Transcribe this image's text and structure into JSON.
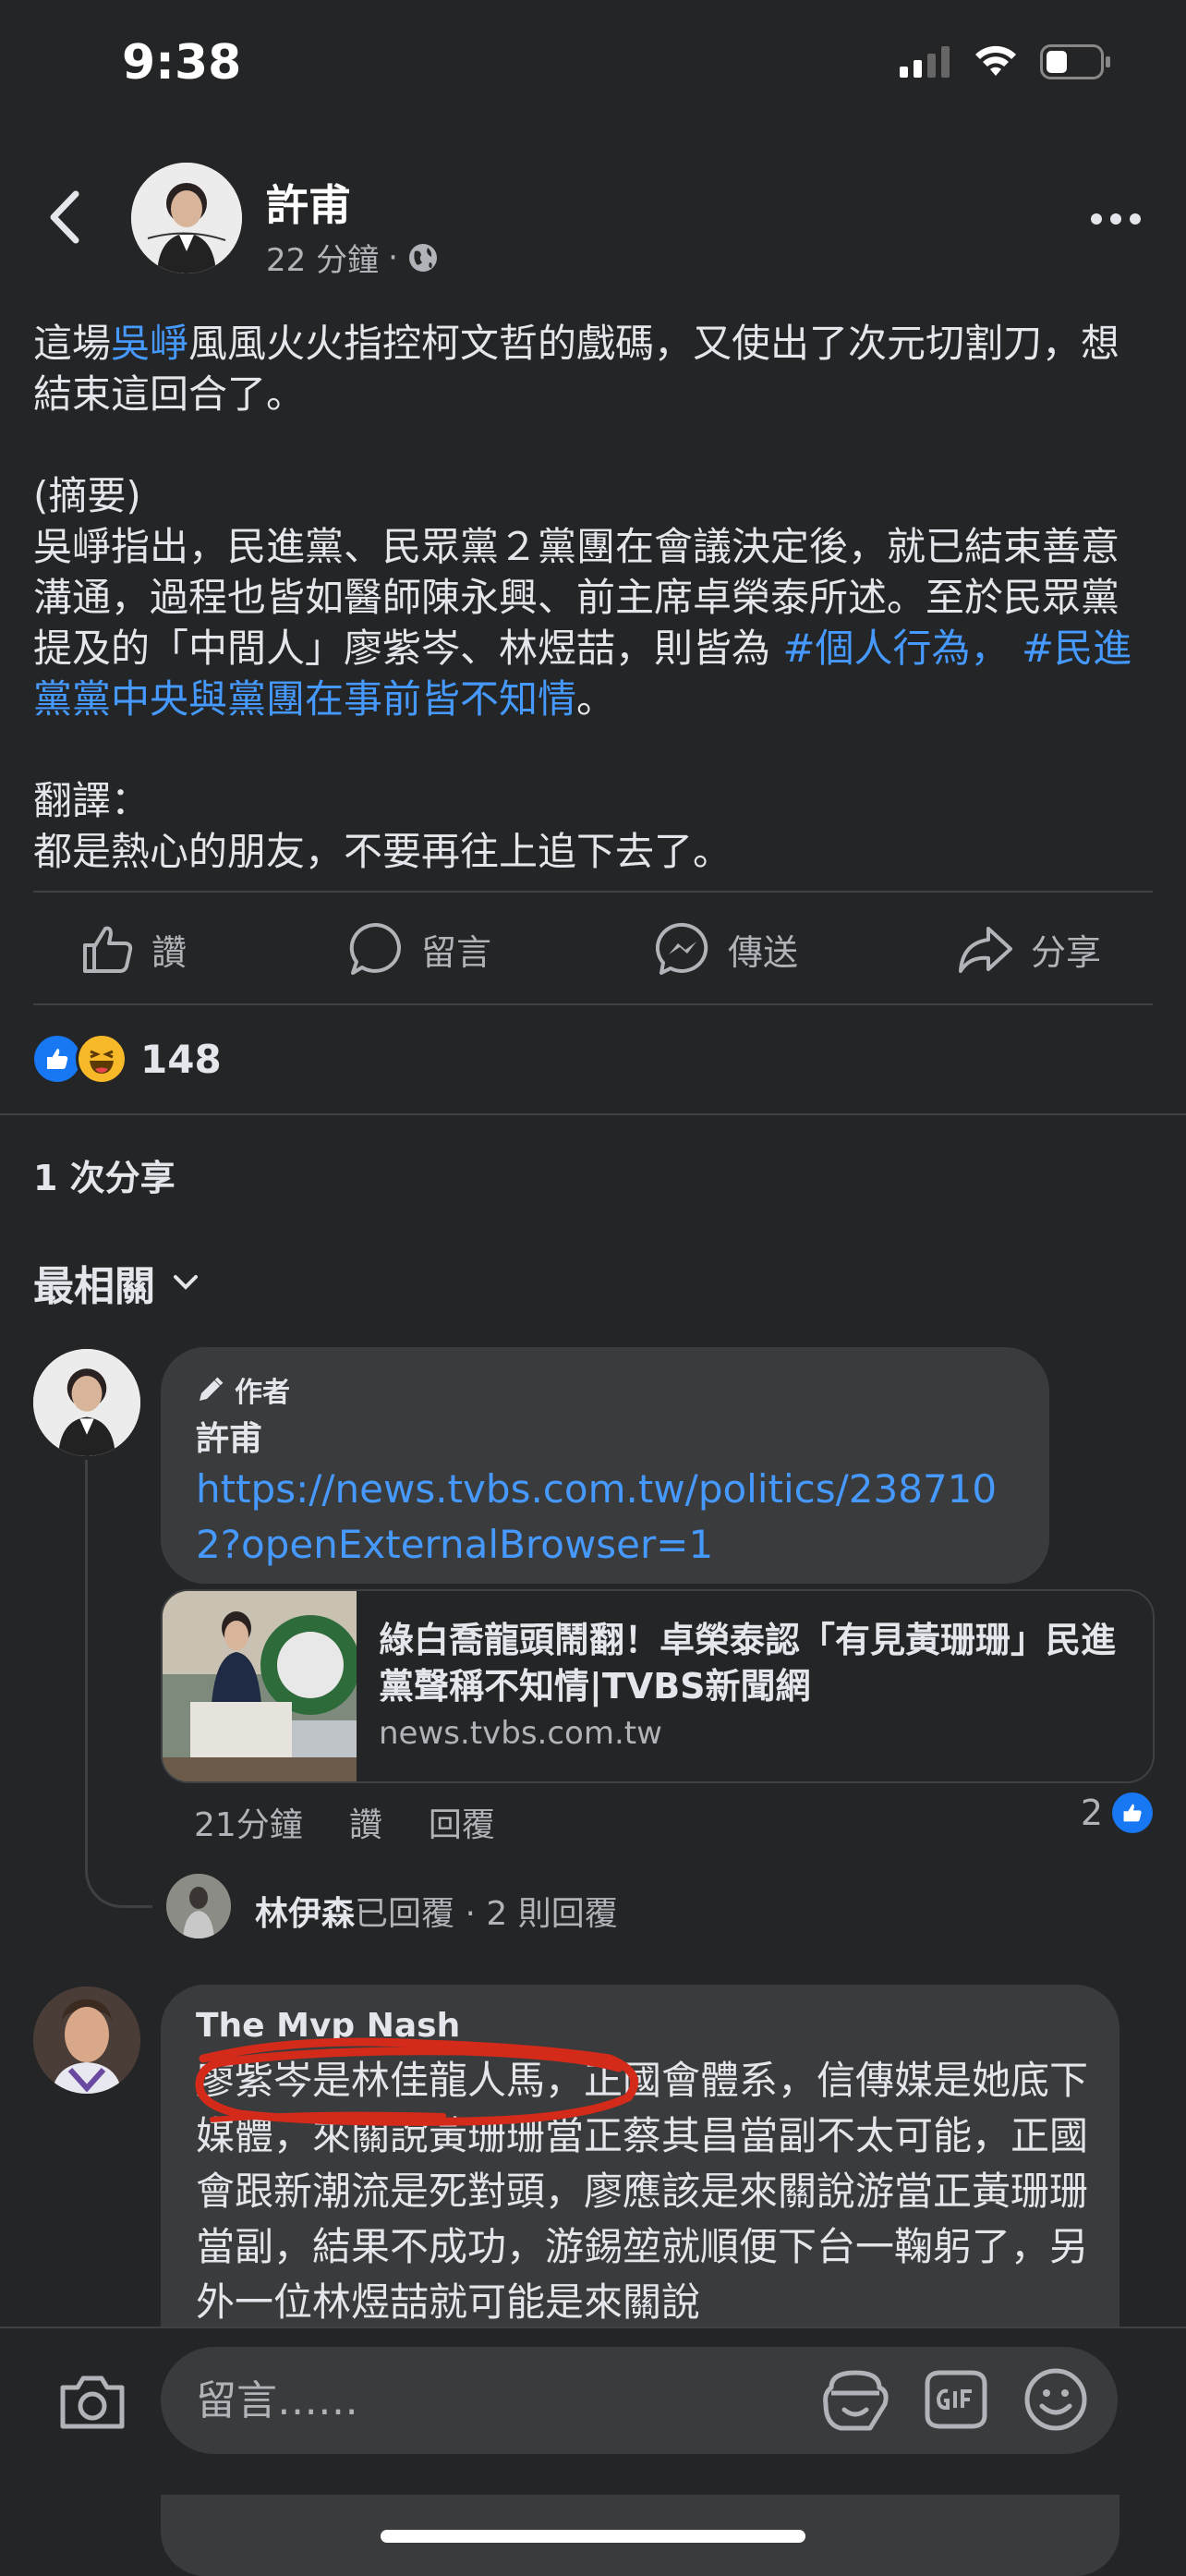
{
  "status_bar": {
    "time": "9:38"
  },
  "post": {
    "author": "許甫",
    "time": "22 分鐘",
    "meta_separator": "·",
    "body": {
      "p1_pre": "這場",
      "p1_link": "吳崢",
      "p1_post": "風風火火指控柯文哲的戲碼，又使出了次元切割刀，想結束這回合了。",
      "p2_label": "(摘要)",
      "p2_text": "吳崢指出，民進黨、民眾黨２黨團在會議決定後，就已結束善意溝通，過程也皆如醫師陳永興、前主席卓榮泰所述。至於民眾黨提及的「中間人」廖紫岑、林煜喆，則皆為 ",
      "p2_hashtag1": "#個人行為",
      "p2_sep": "， ",
      "p2_hashtag2": "#民進黨黨中央與黨團在事前皆不知情",
      "p2_end": "。",
      "p3_label": "翻譯：",
      "p3_text": "都是熱心的朋友，不要再往上追下去了。"
    }
  },
  "actions": {
    "like": "讚",
    "comment": "留言",
    "send": "傳送",
    "share": "分享"
  },
  "reactions": {
    "count": "148",
    "icons": [
      "like-icon",
      "haha-icon"
    ]
  },
  "shares": "1 次分享",
  "sort": {
    "label": "最相關"
  },
  "comments": [
    {
      "badge": "作者",
      "name": "許甫",
      "link": "https://news.tvbs.com.tw/politics/2387102?openExternalBrowser=1",
      "preview": {
        "title": "綠白喬龍頭鬧翻！卓榮泰認「有見黃珊珊」民進黨聲稱不知情|TVBS新聞網",
        "domain": "news.tvbs.com.tw"
      },
      "time": "21分鐘",
      "like": "讚",
      "reply": "回覆",
      "like_count": "2",
      "reply_summary": {
        "name": "林伊森",
        "action": "已回覆",
        "count": " · 2 則回覆"
      }
    },
    {
      "name": "The Mvp Nash",
      "text": "廖紫岑是林佳龍人馬，正國會體系，信傳媒是她底下媒體，來關說黃珊珊當正蔡其昌當副不太可能，正國會跟新潮流是死對頭，廖應該是來關說游當正黃珊珊當副，結果不成功，游錫堃就順便下台一鞠躬了，另外一位林煜喆就可能是來關說"
    }
  ],
  "composer": {
    "placeholder": "留言……"
  },
  "colors": {
    "background": "#242526",
    "bubble": "#3a3b3c",
    "link": "#4599ff",
    "like_blue": "#1877f2",
    "haha_yellow": "#f7b928",
    "scribble_red": "#d42a1a"
  }
}
